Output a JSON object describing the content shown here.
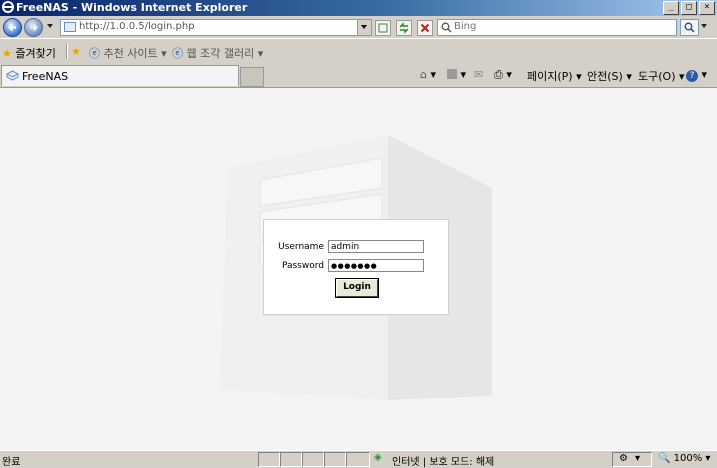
{
  "window": {
    "title": "FreeNAS - Windows Internet Explorer"
  },
  "address": {
    "url": "http://1.0.0.5/login.php"
  },
  "search": {
    "placeholder": "Bing"
  },
  "favorites": {
    "label": "즐겨찾기",
    "items": [
      "추천 사이트",
      "웹 조각 갤러리"
    ]
  },
  "tabs": [
    {
      "label": "FreeNAS"
    }
  ],
  "commands": {
    "page": "페이지(P)",
    "safety": "안전(S)",
    "tools": "도구(O)"
  },
  "login": {
    "username_label": "Username",
    "username_value": "admin",
    "password_label": "Password",
    "password_value": "●●●●●●●",
    "button": "Login"
  },
  "status": {
    "text": "완료",
    "zone": "인터넷 | 보호 모드: 해제",
    "zoom": "100%"
  },
  "colors": {
    "title_start": "#0a246a",
    "title_end": "#a6caf0",
    "content_bg": "#f4f4f4"
  }
}
